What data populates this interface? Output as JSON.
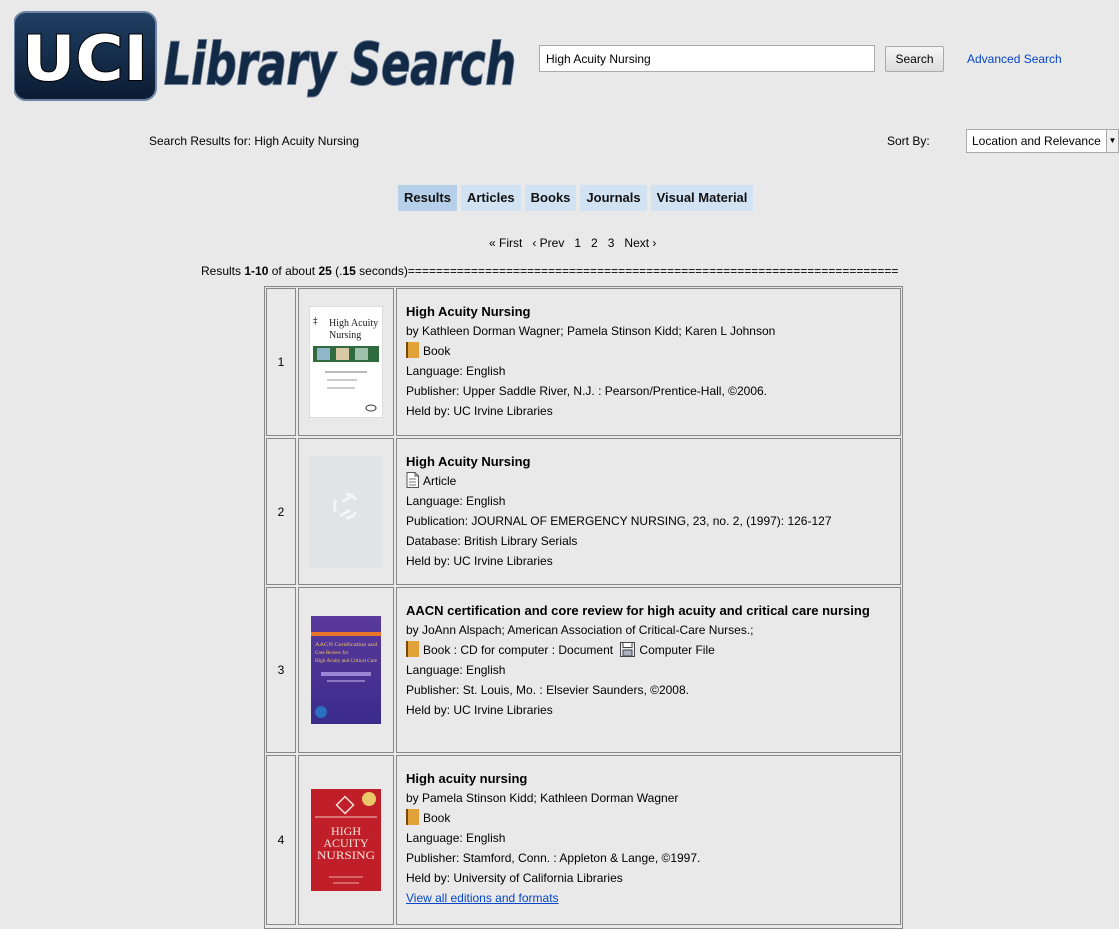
{
  "logo": {
    "left_word": "UCI",
    "right_words": "Library Search"
  },
  "search": {
    "value": "High Acuity Nursing",
    "button_label": "Search",
    "advanced_label": "Advanced Search"
  },
  "results_header": {
    "label": "Search Results for: High Acuity Nursing",
    "sort_label": "Sort By:",
    "sort_value": "Location and Relevance"
  },
  "tabs": [
    {
      "label": "Results",
      "active": true
    },
    {
      "label": "Articles"
    },
    {
      "label": "Books"
    },
    {
      "label": "Journals"
    },
    {
      "label": "Visual Material"
    }
  ],
  "pagination": {
    "first": "« First",
    "prev": "‹ Prev",
    "pages": [
      "1",
      "2",
      "3"
    ],
    "next": "Next ›"
  },
  "summary": {
    "prefix": "Results ",
    "range": "1-10",
    "of_text": " of about ",
    "total": "25",
    "time_prefix": " (.",
    "time": "15",
    "time_suffix": " seconds)======================================================================"
  },
  "results": [
    {
      "num": "1",
      "title": "High Acuity Nursing",
      "by": "by Kathleen Dorman Wagner; Pamela Stinson Kidd; Karen L Johnson",
      "format": "Book",
      "language": "Language: English",
      "publisher": "Publisher: Upper Saddle River, N.J. : Pearson/Prentice-Hall, ©2006.",
      "held": "Held by: UC Irvine Libraries",
      "cover_title_1": "High Acuity",
      "cover_title_2": "Nursing"
    },
    {
      "num": "2",
      "title": "High Acuity Nursing",
      "format": "Article",
      "language": "Language: English",
      "publication": "Publication: JOURNAL OF EMERGENCY NURSING, 23, no. 2, (1997): 126-127",
      "database": "Database: British Library Serials",
      "held": "Held by: UC Irvine Libraries"
    },
    {
      "num": "3",
      "title": "AACN certification and core review for high acuity and critical care nursing",
      "by": "by JoAnn Alspach; American Association of Critical-Care Nurses.;",
      "format_prefix": "Book : CD for computer : Document",
      "format_suffix": "Computer File",
      "language": "Language: English",
      "publisher": "Publisher: St. Louis, Mo. : Elsevier Saunders, ©2008.",
      "held": "Held by: UC Irvine Libraries",
      "cover_title_1": "AACN Certification and",
      "cover_title_2": "Core Review for",
      "cover_title_3": "High Acuity and Critical Care"
    },
    {
      "num": "4",
      "title": "High acuity nursing",
      "by": "by Pamela Stinson Kidd; Kathleen Dorman Wagner",
      "format": "Book",
      "language": "Language: English",
      "publisher": "Publisher: Stamford, Conn. : Appleton & Lange, ©1997.",
      "held": "Held by: University of California Libraries",
      "link": "View all editions and formats",
      "cover_title_1": "HIGH",
      "cover_title_2": "ACUITY",
      "cover_title_3": "NURSING"
    }
  ],
  "colors": {
    "link": "#0645c9",
    "tab_bg": "#d1e2f3",
    "tab_active_bg": "#b6d0ea",
    "page_bg": "#e9e9e9"
  }
}
